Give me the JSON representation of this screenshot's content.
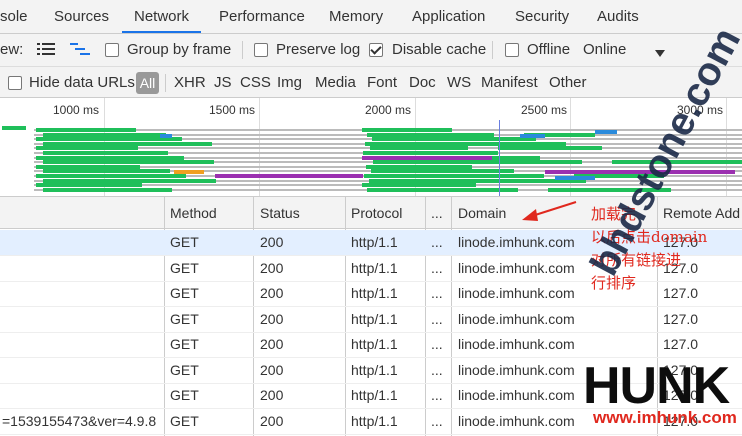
{
  "tabs": [
    {
      "label": "sole"
    },
    {
      "label": "Sources"
    },
    {
      "label": "Network"
    },
    {
      "label": "Performance"
    },
    {
      "label": "Memory"
    },
    {
      "label": "Application"
    },
    {
      "label": "Security"
    },
    {
      "label": "Audits"
    }
  ],
  "toolbar": {
    "view_label": "ew:",
    "group_by_frame": "Group by frame",
    "preserve_log": "Preserve log",
    "disable_cache": "Disable cache",
    "disable_cache_checked": true,
    "offline": "Offline",
    "throttle": "Online"
  },
  "filter": {
    "hide_data_urls": "Hide data URLs",
    "all": "All",
    "types": [
      "XHR",
      "JS",
      "CSS",
      "Img",
      "Media",
      "Font",
      "Doc",
      "WS",
      "Manifest",
      "Other"
    ]
  },
  "overview": {
    "ticks": [
      "1000 ms",
      "1500 ms",
      "2000 ms",
      "2500 ms",
      "3000 ms"
    ]
  },
  "columns": {
    "method": "Method",
    "status": "Status",
    "protocol": "Protocol",
    "more": "...",
    "domain": "Domain",
    "remote": "Remote Add"
  },
  "rows": [
    {
      "name": "",
      "method": "GET",
      "status": "200",
      "protocol": "http/1.1",
      "more": "...",
      "domain": "linode.imhunk.com",
      "remote": "127.0"
    },
    {
      "name": "",
      "method": "GET",
      "status": "200",
      "protocol": "http/1.1",
      "more": "...",
      "domain": "linode.imhunk.com",
      "remote": "127.0"
    },
    {
      "name": "",
      "method": "GET",
      "status": "200",
      "protocol": "http/1.1",
      "more": "...",
      "domain": "linode.imhunk.com",
      "remote": "127.0"
    },
    {
      "name": "",
      "method": "GET",
      "status": "200",
      "protocol": "http/1.1",
      "more": "...",
      "domain": "linode.imhunk.com",
      "remote": "127.0"
    },
    {
      "name": "",
      "method": "GET",
      "status": "200",
      "protocol": "http/1.1",
      "more": "...",
      "domain": "linode.imhunk.com",
      "remote": "127.0"
    },
    {
      "name": "",
      "method": "GET",
      "status": "200",
      "protocol": "http/1.1",
      "more": "...",
      "domain": "linode.imhunk.com",
      "remote": "127.0"
    },
    {
      "name": "",
      "method": "GET",
      "status": "200",
      "protocol": "http/1.1",
      "more": "...",
      "domain": "linode.imhunk.com",
      "remote": "127.0"
    },
    {
      "name": "=1539155473&ver=4.9.8",
      "method": "GET",
      "status": "200",
      "protocol": "http/1.1",
      "more": "...",
      "domain": "linode.imhunk.com",
      "remote": "127.0"
    }
  ],
  "annotation": [
    "加载完",
    "以后点击domain",
    "对所有链接进",
    "行排序"
  ],
  "watermark": {
    "site": "bhdstone.com",
    "brand": "HUNK",
    "url": "www.imhunk.com"
  },
  "colors": {
    "accent": "#1a73e8",
    "annotation": "#e0281e",
    "bar_green": "#1fbf5a",
    "bar_purple": "#9b30b0",
    "bar_blue": "#2a8bdc",
    "bar_orange": "#f0a020"
  }
}
